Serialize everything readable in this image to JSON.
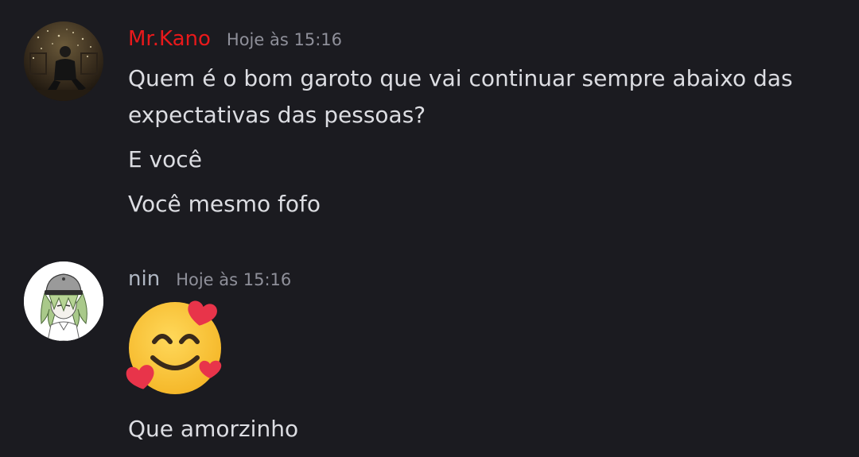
{
  "theme": {
    "background": "#1b1b20",
    "text_color": "#dcdde2",
    "timestamp_color": "#8f909a"
  },
  "messages": [
    {
      "author": "Mr.Kano",
      "author_color": "#e8191b",
      "timestamp": "Hoje às 15:16",
      "avatar_icon": "user-photo-avatar",
      "lines": [
        "Quem é o bom garoto que vai continuar sempre abaixo das",
        "expectativas das pessoas?",
        "E você",
        "Você mesmo fofo"
      ]
    },
    {
      "author": "nin",
      "author_color": "#b0b7c3",
      "timestamp": "Hoje às 15:16",
      "avatar_icon": "anime-character-avatar",
      "emoji": "smiling-face-with-hearts-icon",
      "lines": [
        "Que amorzinho"
      ]
    }
  ]
}
